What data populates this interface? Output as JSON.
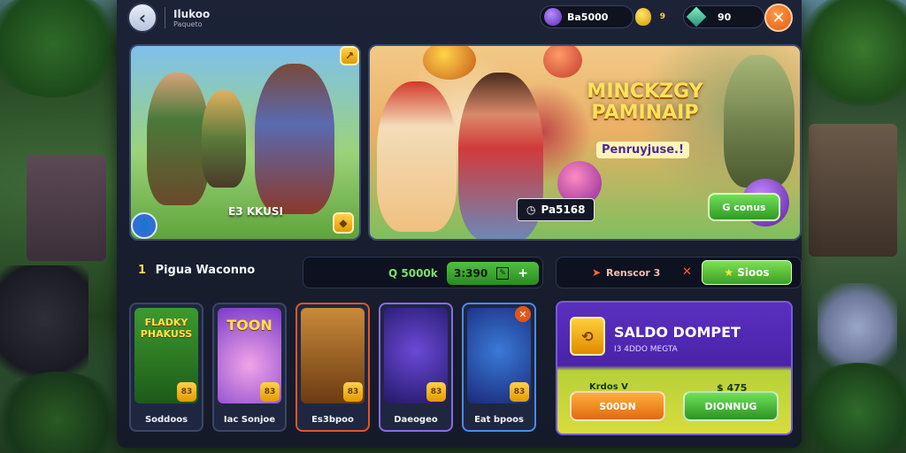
{
  "header": {
    "title": "Ilukoo",
    "subtitle": "Paqueto",
    "back_icon": "back-arrow-icon",
    "coin_balance": "Ba5000",
    "gold_count": "9",
    "gem_balance": "90",
    "close_icon": "close-icon"
  },
  "banners": {
    "left_tag": "E3 KKUSI",
    "right_title": "MINCKZGY PAMINAIP",
    "right_subtitle": "Penruyjuse.!",
    "right_chip": "Pa5168",
    "right_cta": "G conus"
  },
  "filter": {
    "number": "1",
    "label": "Pigua Waconno",
    "pill_text": "Q 5000k",
    "pill_value": "3:390",
    "rewards_text": "Renscor 3",
    "rewards_button": "Sioos"
  },
  "games": [
    {
      "label": "Soddoos",
      "art_text": "FLADKY PHAKUSS",
      "color_a": "#3c9a2e",
      "color_b": "#1e5a1a",
      "border": "#5fd04a"
    },
    {
      "label": "Iac Sonjoe",
      "art_text": "TOON",
      "color_a": "#f0a4e8",
      "color_b": "#7a3bc8",
      "border": "#6a78c8"
    },
    {
      "label": "Es3bpoo",
      "art_text": "",
      "color_a": "#c98a3a",
      "color_b": "#6a3a12",
      "border": "#e2562a"
    },
    {
      "label": "Daeogeo",
      "art_text": "",
      "color_a": "#6a4ad8",
      "color_b": "#241868",
      "border": "#8a6ae8"
    },
    {
      "label": "Eat bpoos",
      "art_text": "",
      "color_a": "#3a7ad8",
      "color_b": "#1a2a7a",
      "border": "#4a8af0"
    }
  ],
  "wallet": {
    "title": "SALDO DOMPET",
    "subtitle": "I3 4DDO MEGTA",
    "left_label": "Krdos V",
    "left_button": "S00DN",
    "right_label": "$ 475",
    "right_button": "DIONNUG"
  },
  "colors": {
    "accent_green": "#3aa022",
    "accent_orange": "#e25a10",
    "accent_purple": "#5a2fc0"
  }
}
